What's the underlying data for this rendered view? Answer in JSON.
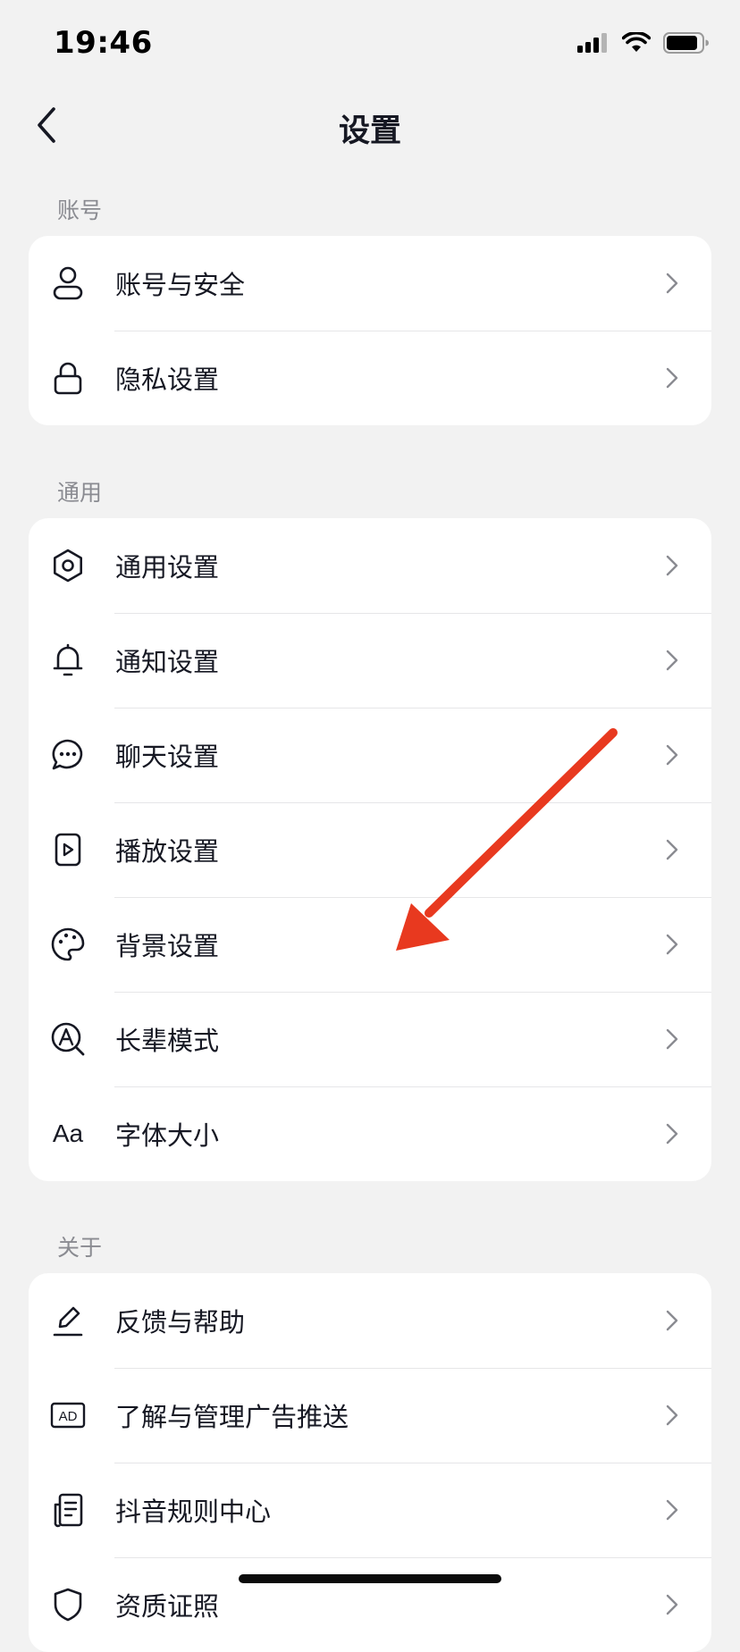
{
  "status_bar": {
    "time": "19:46"
  },
  "nav": {
    "title": "设置"
  },
  "sections": {
    "account": {
      "label": "账号",
      "items": [
        {
          "label": "账号与安全",
          "icon": "user-icon"
        },
        {
          "label": "隐私设置",
          "icon": "lock-icon"
        }
      ]
    },
    "general": {
      "label": "通用",
      "items": [
        {
          "label": "通用设置",
          "icon": "gear-icon"
        },
        {
          "label": "通知设置",
          "icon": "bell-icon"
        },
        {
          "label": "聊天设置",
          "icon": "chat-icon"
        },
        {
          "label": "播放设置",
          "icon": "play-icon"
        },
        {
          "label": "背景设置",
          "icon": "palette-icon"
        },
        {
          "label": "长辈模式",
          "icon": "elder-mode-icon"
        },
        {
          "label": "字体大小",
          "icon": "font-size-icon",
          "icon_text": "Aa"
        }
      ]
    },
    "about": {
      "label": "关于",
      "items": [
        {
          "label": "反馈与帮助",
          "icon": "pencil-icon"
        },
        {
          "label": "了解与管理广告推送",
          "icon": "ad-icon",
          "icon_text": "AD"
        },
        {
          "label": "抖音规则中心",
          "icon": "document-icon"
        },
        {
          "label": "资质证照",
          "icon": "shield-icon"
        }
      ]
    }
  },
  "colors": {
    "background": "#f2f2f2",
    "card": "#ffffff",
    "text": "#161823",
    "secondary_text": "#8a8b91",
    "annotation_arrow": "#e8391f"
  }
}
